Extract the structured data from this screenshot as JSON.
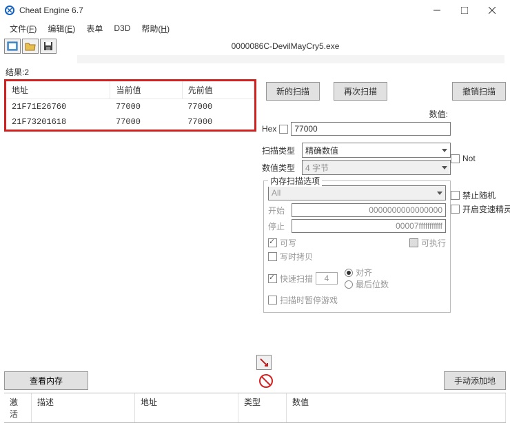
{
  "window": {
    "title": "Cheat Engine 6.7"
  },
  "menu": {
    "file": "文件(",
    "file_u": "F",
    "file_end": ")",
    "edit": "编辑(",
    "edit_u": "E",
    "edit_end": ")",
    "table": "表单",
    "d3d": "D3D",
    "help": "帮助(",
    "help_u": "H",
    "help_end": ")"
  },
  "process": {
    "label": "0000086C-DevilMayCry5.exe"
  },
  "results": {
    "label": "结果:",
    "count": "2",
    "headers": {
      "addr": "地址",
      "cur": "当前值",
      "prev": "先前值"
    },
    "rows": [
      {
        "addr": "21F71E26760",
        "cur": "77000",
        "prev": "77000"
      },
      {
        "addr": "21F73201618",
        "cur": "77000",
        "prev": "77000"
      }
    ]
  },
  "scan": {
    "new": "新的扫描",
    "next": "再次扫描",
    "undo": "撤销扫描"
  },
  "value": {
    "label": "数值:",
    "hex": "Hex",
    "input": "77000"
  },
  "scantype": {
    "label": "扫描类型",
    "value": "精确数值",
    "not": "Not"
  },
  "valuetype": {
    "label": "数值类型",
    "value": "4 字节"
  },
  "memopts": {
    "title": "内存扫描选项",
    "all": "All",
    "start_label": "开始",
    "start_val": "0000000000000000",
    "stop_label": "停止",
    "stop_val": "00007fffffffffff",
    "writable": "可写",
    "executable": "可执行",
    "cow": "写时拷贝",
    "fastscan": "快速扫描",
    "fast_val": "4",
    "align": "对齐",
    "lastdigits": "最后位数",
    "pause": "扫描时暂停游戏"
  },
  "sideopts": {
    "norandom": "禁止随机",
    "speedhack": "开启变速精灵"
  },
  "bottom": {
    "viewmem": "查看内存",
    "manualadd": "手动添加地"
  },
  "addrlist": {
    "active": "激活",
    "desc": "描述",
    "addr": "地址",
    "type": "类型",
    "value": "数值"
  }
}
